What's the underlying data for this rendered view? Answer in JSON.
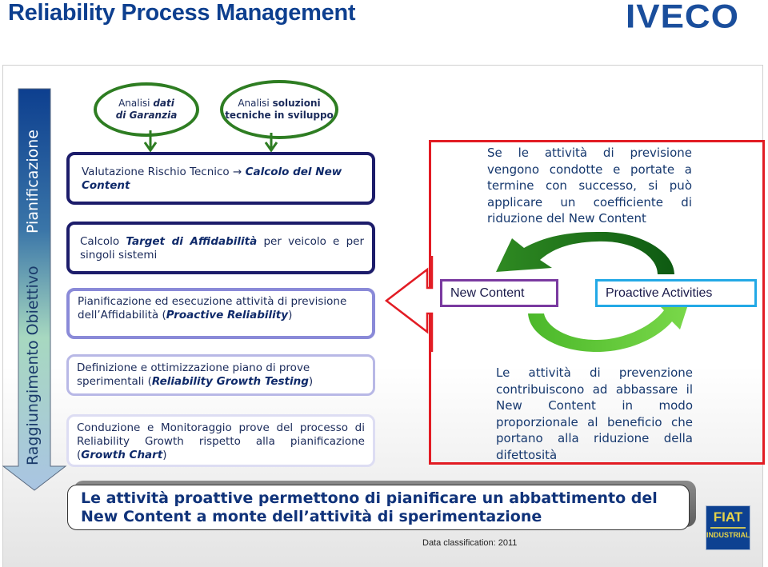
{
  "header": {
    "title": "Reliability Process Management",
    "logo": "IVECO"
  },
  "side_arrow": {
    "label_top": "Pianificazione",
    "label_bottom": "Raggiungimento Obiettivo",
    "colors": {
      "top": "#0d3f8f",
      "middle": "#a7d8c0",
      "bottom": "#a9c4e2"
    }
  },
  "inputs": [
    {
      "normal": "Analisi",
      "bold": "dati di Garanzia",
      "line1_normal": "Analisi ",
      "line1_bold": "dati",
      "line2_bold": "di Garanzia"
    },
    {
      "normal": "Analisi",
      "bold": "soluzioni tecniche in sviluppo",
      "line1_normal": "Analisi ",
      "line1_bold": "soluzioni",
      "line2_bold": "tecniche in sviluppo"
    }
  ],
  "steps": [
    {
      "pre": "Valutazione Rischio Tecnico → ",
      "bold": "Calcolo del New Content",
      "post": ""
    },
    {
      "pre": "Calcolo ",
      "bold": "Target di Affidabilità",
      "post": " per veicolo e per singoli sistemi"
    },
    {
      "pre": "Pianificazione ed esecuzione attività di previsione dell’Affidabilità (",
      "bold": "Proactive Reliability",
      "post": ")"
    },
    {
      "pre": "Definizione e ottimizzazione piano di prove sperimentali (",
      "bold": "Reliability Growth Testing",
      "post": ")"
    },
    {
      "pre": "Conduzione e Monitoraggio prove del processo di Reliability Growth rispetto alla pianificazione (",
      "bold": "Growth Chart",
      "post": ")"
    }
  ],
  "cycle": {
    "top_text": "Se le attività di previsione vengono condotte e portate a termine con successo, si può applicare un coefficiente di riduzione del New Content",
    "left_node": "New Content",
    "right_node": "Proactive Activities",
    "bottom_text": "Le attività di prevenzione contribuiscono ad abbassare il New Content in modo proporzionale al beneficio che portano alla riduzione della difettosità",
    "colors": {
      "frame": "#e21c24",
      "arrow_top": "#1e6b1a",
      "arrow_bottom": "#5cc22e",
      "left_border": "#7a3aa0",
      "right_border": "#23a9e6"
    }
  },
  "conclusion": {
    "text": "Le attività proattive permettono di pianificare un abbattimento del New Content a monte dell’attività di sperimentazione"
  },
  "footer": {
    "data_classification": "Data classification: 2011",
    "logo_line1": "FIAT",
    "logo_line2": "INDUSTRIAL"
  }
}
